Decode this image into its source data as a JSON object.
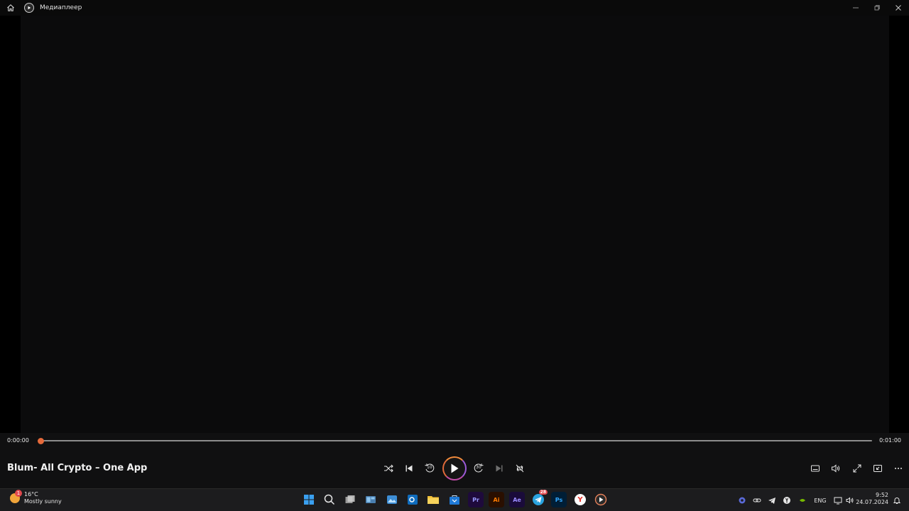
{
  "window": {
    "title": "Медиаплеер",
    "home_icon": "home-icon",
    "app_icon": "media-player-icon",
    "controls": [
      "minimize-icon",
      "restore-icon",
      "close-icon"
    ]
  },
  "player": {
    "current_time": "0:00:00",
    "total_time": "0:01:00",
    "progress": 0,
    "now_playing": "Blum- All Crypto – One App",
    "seek_back": "10",
    "seek_forward": "30",
    "buttons": [
      "shuffle-icon",
      "previous-icon",
      "rewind-10-icon",
      "play-icon",
      "forward-30-icon",
      "next-icon",
      "repeat-off-icon"
    ],
    "right_buttons": [
      "subtitles-icon",
      "volume-icon",
      "fullscreen-icon",
      "mini-player-icon",
      "more-icon"
    ]
  },
  "taskbar": {
    "weather": {
      "temp": "16°C",
      "desc": "Mostly sunny",
      "badge": "1"
    },
    "apps": [
      {
        "name": "start",
        "label": ""
      },
      {
        "name": "search",
        "label": ""
      },
      {
        "name": "task-view",
        "label": ""
      },
      {
        "name": "widgets",
        "label": ""
      },
      {
        "name": "photos",
        "label": ""
      },
      {
        "name": "outlook",
        "label": ""
      },
      {
        "name": "file-explorer",
        "label": ""
      },
      {
        "name": "store",
        "label": ""
      },
      {
        "name": "premiere",
        "label": "Pr"
      },
      {
        "name": "illustrator",
        "label": "Ai"
      },
      {
        "name": "after-effects",
        "label": "Ae"
      },
      {
        "name": "telegram",
        "label": "",
        "badge": "28"
      },
      {
        "name": "photoshop",
        "label": "Ps"
      },
      {
        "name": "yandex-browser",
        "label": "Y"
      },
      {
        "name": "media-player",
        "label": ""
      }
    ],
    "tray": {
      "language": "ENG"
    },
    "clock": {
      "time": "9:52",
      "date": "24.07.2024"
    }
  },
  "colors": {
    "accent": "#e56a3b",
    "titlebar": "#0a0a0a",
    "controls_bg": "#101011",
    "taskbar": "#1c1c1e"
  }
}
